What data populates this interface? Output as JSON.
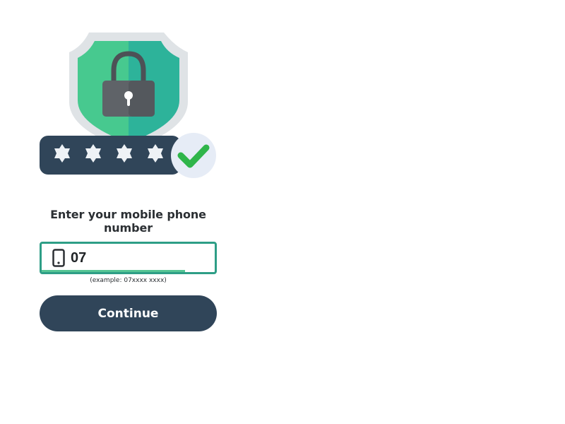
{
  "colors": {
    "shield_primary": "#47c98f",
    "shield_secondary": "#2db39a",
    "shield_rim": "#dfe3e6",
    "lock_body": "#5f6368",
    "password_bar": "#304559",
    "check": "#2fb54a",
    "field_border": "#2e9e86",
    "button_bg": "#304559"
  },
  "illustration": {
    "icon": "shield-lock-icon",
    "masked_chars": 4,
    "mask_icon": "asterisk-icon",
    "status_icon": "check-icon"
  },
  "form": {
    "prompt": "Enter your mobile phone number",
    "phone_icon": "mobile-phone-icon",
    "phone_value": "07",
    "entry_progress": 0.83,
    "example_hint": "(example: 07xxxx xxxx)",
    "continue_label": "Continue"
  }
}
